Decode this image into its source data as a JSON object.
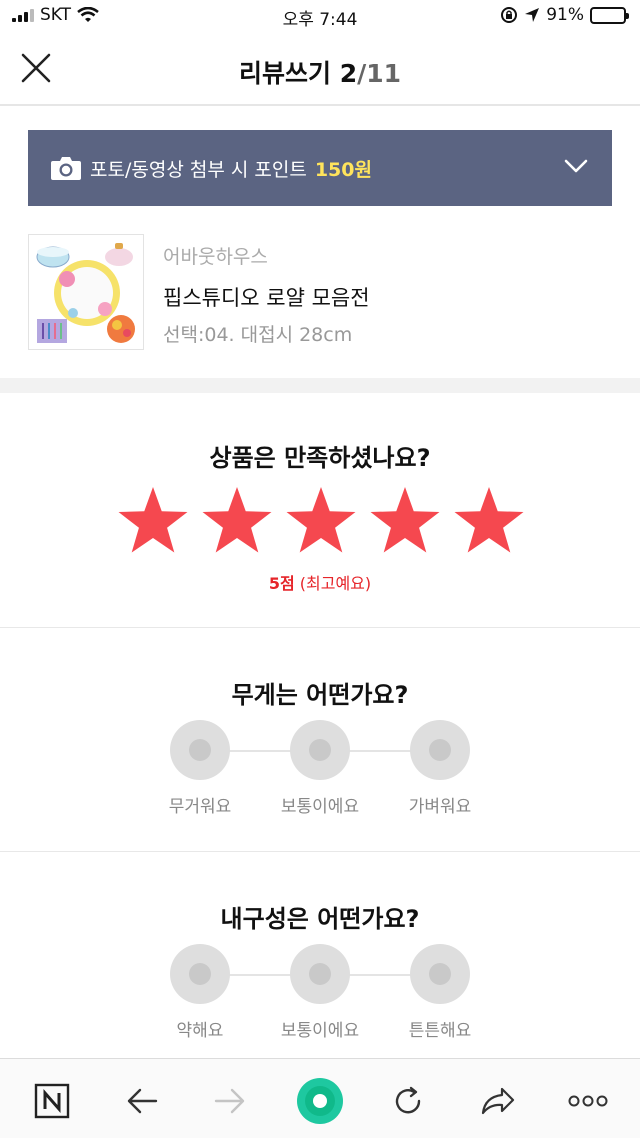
{
  "status_bar": {
    "carrier": "SKT",
    "time": "오후 7:44",
    "battery": "91%",
    "battery_level": 0.91
  },
  "header": {
    "title": "리뷰쓰기",
    "current": "2",
    "total": "/11"
  },
  "banner": {
    "text": "포토/동영상 첨부 시 포인트",
    "point": "150원",
    "colors": {
      "background": "#5b6482",
      "point": "#ffe45c"
    }
  },
  "product": {
    "brand": "어바웃하우스",
    "name": "핍스튜디오 로얄 모음전",
    "option": "선택:04. 대접시 28cm"
  },
  "rating": {
    "question": "상품은 만족하셨나요?",
    "score_value": 5,
    "max": 5,
    "score_label": "5점",
    "score_text": "(최고예요)",
    "star_color": "#f5484f"
  },
  "weight": {
    "question": "무게는 어떤가요?",
    "options": [
      "무거워요",
      "보통이에요",
      "가벼워요"
    ]
  },
  "durability": {
    "question": "내구성은 어떤가요?",
    "options": [
      "약해요",
      "보통이에요",
      "튼튼해요"
    ]
  },
  "toolbar": {
    "items": [
      "naver-home-icon",
      "back-icon",
      "forward-icon",
      "green-dot-icon",
      "refresh-icon",
      "share-icon",
      "more-icon"
    ],
    "green": "#1ec800"
  }
}
